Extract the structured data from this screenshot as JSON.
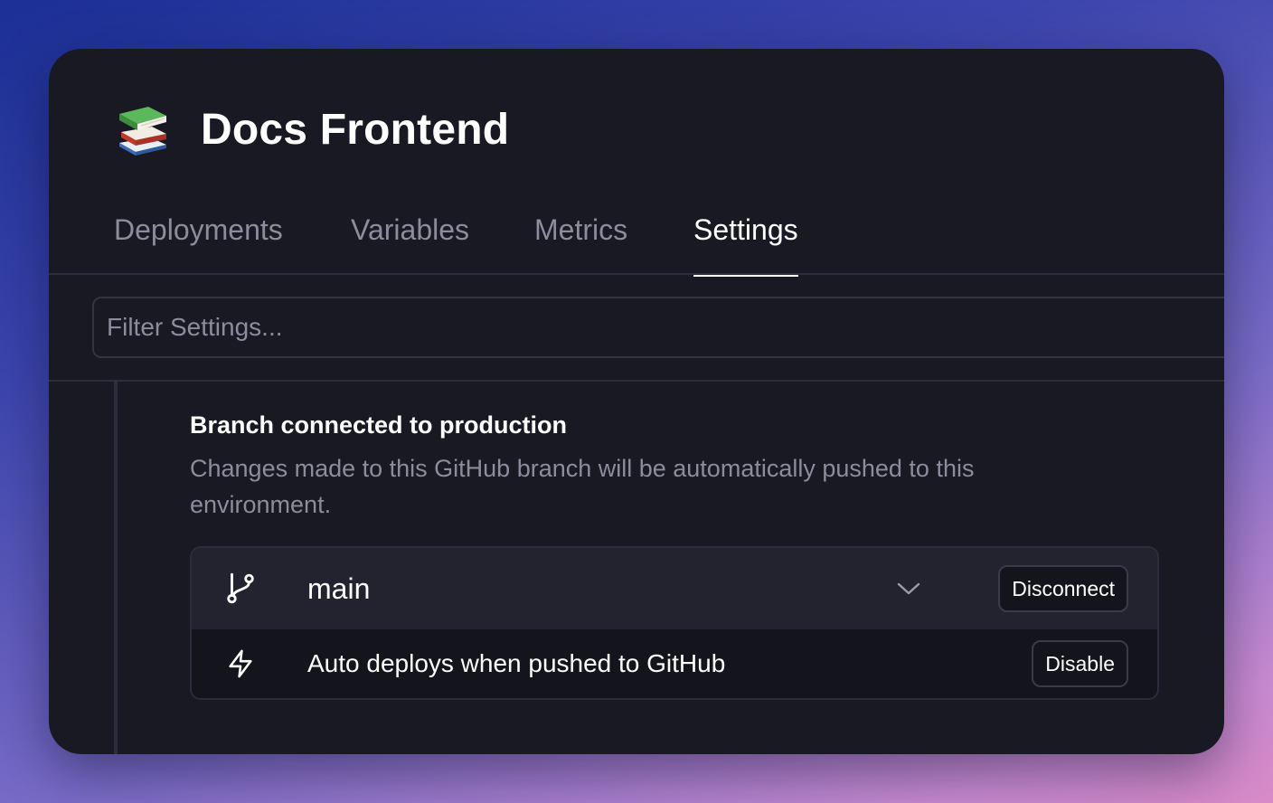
{
  "app": {
    "title": "Docs Frontend",
    "icon": "books-icon"
  },
  "tabs": [
    {
      "label": "Deployments",
      "active": false
    },
    {
      "label": "Variables",
      "active": false
    },
    {
      "label": "Metrics",
      "active": false
    },
    {
      "label": "Settings",
      "active": true
    }
  ],
  "filter": {
    "placeholder": "Filter Settings...",
    "value": ""
  },
  "section": {
    "title": "Branch connected to production",
    "description": "Changes made to this GitHub branch will be automatically pushed to this environment.",
    "branch": {
      "name": "main",
      "icon": "git-branch-icon",
      "button_label": "Disconnect"
    },
    "auto_deploy": {
      "text": "Auto deploys when pushed to GitHub",
      "icon": "lightning-icon",
      "button_label": "Disable"
    }
  },
  "colors": {
    "panel_bg": "#191924",
    "text_primary": "#ffffff",
    "text_muted": "#8c8c9c",
    "border": "#2c2c3a"
  }
}
